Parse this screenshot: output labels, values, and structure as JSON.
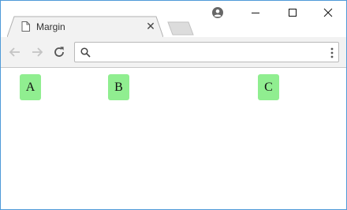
{
  "browser": {
    "tab": {
      "title": "Margin",
      "close_glyph": "✕",
      "icon": "file-icon"
    },
    "window_controls": {
      "minimize_icon": "minimize-icon",
      "maximize_icon": "maximize-icon",
      "close_icon": "close-icon"
    },
    "profile_icon": "account-circle-icon",
    "toolbar": {
      "back_icon": "arrow-left-icon",
      "forward_icon": "arrow-right-icon",
      "reload_icon": "reload-icon",
      "menu_icon": "vertical-dots-icon",
      "omnibox": {
        "value": "",
        "placeholder": ""
      }
    }
  },
  "page": {
    "boxes": [
      {
        "label": "A",
        "color": "#90ee90"
      },
      {
        "label": "B",
        "color": "#90ee90"
      },
      {
        "label": "C",
        "color": "#90ee90"
      }
    ]
  },
  "colors": {
    "window_border": "#4f9ad8",
    "tab_bg": "#f2f2f2",
    "toolbar_bg": "#f2f2f2",
    "box_green": "#90ee90"
  }
}
